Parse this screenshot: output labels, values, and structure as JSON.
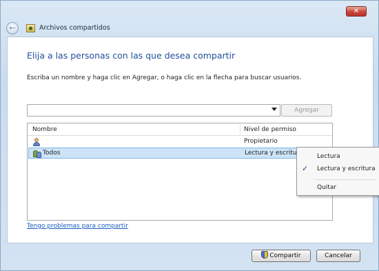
{
  "window": {
    "title": "Archivos compartidos",
    "close_label": "✕"
  },
  "main": {
    "heading": "Elija a las personas con las que desea compartir",
    "instruction": "Escriba un nombre y haga clic en Agregar, o haga clic en la flecha para buscar usuarios.",
    "name_input_value": "",
    "add_button_label": "Agregar",
    "columns": [
      "Nombre",
      "Nivel de permiso"
    ],
    "rows": [
      {
        "name": "",
        "permission": "Propietario",
        "icon": "user-icon"
      },
      {
        "name": "Todos",
        "permission": "Lectura y escritura",
        "icon": "group-icon",
        "selected": true
      }
    ],
    "help_link": "Tengo problemas para compartir"
  },
  "footer": {
    "share_label": "Compartir",
    "cancel_label": "Cancelar"
  },
  "context_menu": {
    "items": [
      {
        "label": "Lectura",
        "checked": false
      },
      {
        "label": "Lectura y escritura",
        "checked": true
      },
      {
        "label": "Quitar",
        "checked": false
      }
    ],
    "check_glyph": "✓"
  }
}
